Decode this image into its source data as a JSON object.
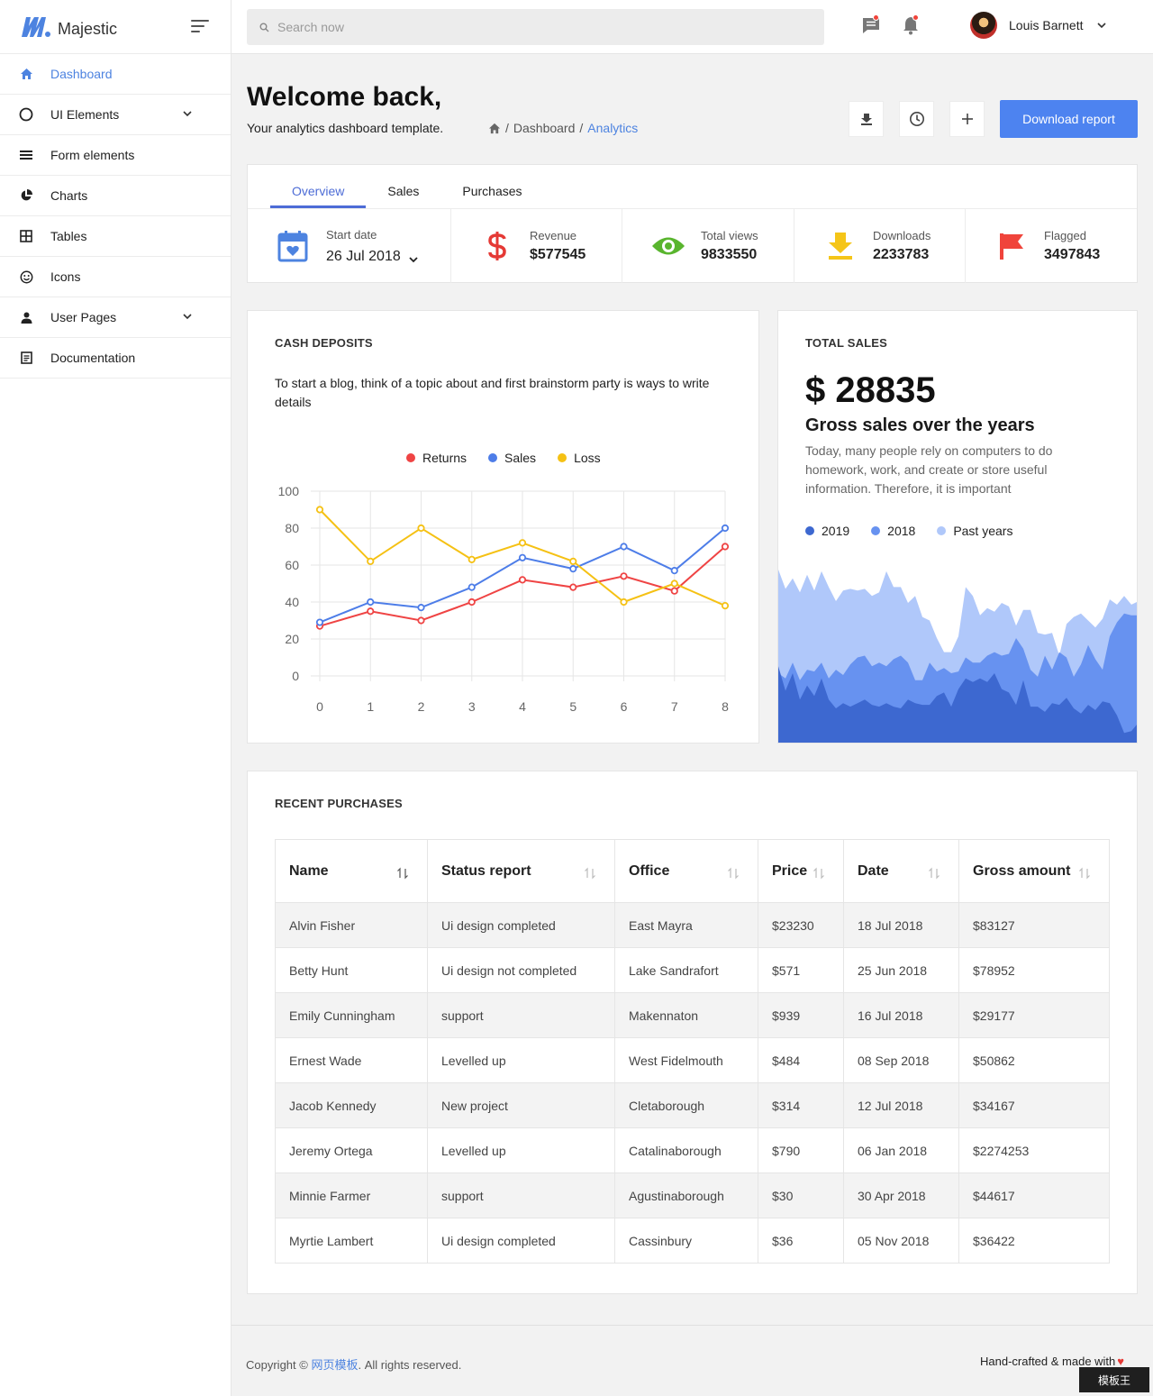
{
  "brand": {
    "name": "Majestic",
    "color": "#4d83e0"
  },
  "sidebar": {
    "items": [
      {
        "label": "Dashboard",
        "icon": "home-icon",
        "active": true
      },
      {
        "label": "UI Elements",
        "icon": "circle-icon",
        "expandable": true
      },
      {
        "label": "Form elements",
        "icon": "list-icon"
      },
      {
        "label": "Charts",
        "icon": "pie-chart-icon"
      },
      {
        "label": "Tables",
        "icon": "grid-icon"
      },
      {
        "label": "Icons",
        "icon": "smiley-icon"
      },
      {
        "label": "User Pages",
        "icon": "user-icon",
        "expandable": true
      },
      {
        "label": "Documentation",
        "icon": "document-icon"
      }
    ]
  },
  "topbar": {
    "search_placeholder": "Search now",
    "user_name": "Louis Barnett"
  },
  "header": {
    "title": "Welcome back,",
    "subtitle": "Your analytics dashboard template.",
    "breadcrumb": [
      "Dashboard",
      "Analytics"
    ],
    "download_label": "Download report"
  },
  "overview": {
    "tabs": [
      "Overview",
      "Sales",
      "Purchases"
    ],
    "stats": [
      {
        "label": "Start date",
        "value": "26 Jul 2018",
        "icon": "calendar-icon",
        "color": "#4d83e0"
      },
      {
        "label": "Revenue",
        "value": "$577545",
        "icon": "dollar-icon",
        "color": "#e53935"
      },
      {
        "label": "Total views",
        "value": "9833550",
        "icon": "eye-icon",
        "color": "#59b52e"
      },
      {
        "label": "Downloads",
        "value": "2233783",
        "icon": "download-icon",
        "color": "#f5c518"
      },
      {
        "label": "Flagged",
        "value": "3497843",
        "icon": "flag-icon",
        "color": "#f0443b"
      }
    ]
  },
  "cash": {
    "title": "CASH DEPOSITS",
    "description": "To start a blog, think of a topic about and first brainstorm party is ways to write details"
  },
  "chart_data": [
    {
      "type": "line",
      "x": [
        0,
        1,
        2,
        3,
        4,
        5,
        6,
        7,
        8
      ],
      "xlim": [
        0,
        8
      ],
      "ylim": [
        0,
        100
      ],
      "yticks": [
        0,
        20,
        40,
        60,
        80,
        100
      ],
      "legend": "top-center",
      "grid": true,
      "series": [
        {
          "name": "Returns",
          "color": "#ef4444",
          "values": [
            27,
            35,
            30,
            40,
            52,
            48,
            54,
            46,
            70
          ]
        },
        {
          "name": "Sales",
          "color": "#4d7de8",
          "values": [
            29,
            40,
            37,
            48,
            64,
            58,
            70,
            57,
            80
          ]
        },
        {
          "name": "Loss",
          "color": "#f5c114",
          "values": [
            90,
            62,
            80,
            63,
            72,
            62,
            40,
            50,
            38
          ]
        }
      ]
    },
    {
      "type": "area",
      "legend": "top-left",
      "grid": false,
      "x": [
        0,
        1,
        2,
        3,
        4,
        5,
        6,
        7,
        8,
        9,
        10,
        11,
        12,
        13,
        14,
        15,
        16,
        17,
        18,
        19,
        20,
        21,
        22,
        23,
        24,
        25,
        26,
        27,
        28,
        29,
        30,
        31,
        32,
        33,
        34,
        35,
        36,
        37,
        38,
        39,
        40,
        41,
        42,
        43,
        44,
        45,
        46,
        47,
        48,
        49,
        50
      ],
      "ylim": [
        0,
        100
      ],
      "series": [
        {
          "name": "2019",
          "color": "#3d68d0",
          "values": [
            44,
            30,
            40,
            25,
            33,
            27,
            37,
            25,
            20,
            23,
            21,
            23,
            25,
            22,
            21,
            23,
            21,
            20,
            25,
            23,
            22,
            22,
            27,
            29,
            21,
            31,
            37,
            35,
            37,
            35,
            40,
            31,
            29,
            22,
            36,
            21,
            21,
            18,
            23,
            22,
            26,
            20,
            17,
            22,
            19,
            24,
            23,
            16,
            6,
            7,
            12
          ]
        },
        {
          "name": "2018",
          "color": "#6792f0",
          "values": [
            40,
            37,
            46,
            36,
            42,
            41,
            46,
            37,
            42,
            39,
            45,
            49,
            50,
            44,
            46,
            44,
            48,
            50,
            46,
            36,
            36,
            46,
            41,
            43,
            40,
            41,
            49,
            46,
            46,
            50,
            52,
            50,
            51,
            60,
            54,
            42,
            38,
            50,
            42,
            52,
            49,
            38,
            45,
            56,
            48,
            42,
            61,
            69,
            74,
            73,
            73
          ]
        },
        {
          "name": "Past years",
          "color": "#b0c8fa",
          "values": [
            99,
            88,
            94,
            86,
            96,
            87,
            98,
            89,
            81,
            87,
            88,
            87,
            88,
            84,
            86,
            98,
            89,
            89,
            80,
            84,
            72,
            70,
            60,
            52,
            52,
            61,
            89,
            84,
            73,
            77,
            75,
            80,
            78,
            67,
            76,
            76,
            63,
            62,
            63,
            50,
            68,
            72,
            74,
            70,
            66,
            71,
            82,
            79,
            84,
            79,
            81
          ]
        }
      ]
    }
  ],
  "total_sales": {
    "title": "TOTAL SALES",
    "amount": "$ 28835",
    "heading": "Gross sales over the years",
    "description": "Today, many people rely on computers to do homework, work, and create or store useful information. Therefore, it is important"
  },
  "purchases": {
    "title": "RECENT PURCHASES",
    "columns": [
      "Name",
      "Status report",
      "Office",
      "Price",
      "Date",
      "Gross amount"
    ],
    "rows": [
      [
        "Alvin Fisher",
        "Ui design completed",
        "East Mayra",
        "$23230",
        "18 Jul 2018",
        "$83127"
      ],
      [
        "Betty Hunt",
        "Ui design not completed",
        "Lake Sandrafort",
        "$571",
        "25 Jun 2018",
        "$78952"
      ],
      [
        "Emily Cunningham",
        "support",
        "Makennaton",
        "$939",
        "16 Jul 2018",
        "$29177"
      ],
      [
        "Ernest Wade",
        "Levelled up",
        "West Fidelmouth",
        "$484",
        "08 Sep 2018",
        "$50862"
      ],
      [
        "Jacob Kennedy",
        "New project",
        "Cletaborough",
        "$314",
        "12 Jul 2018",
        "$34167"
      ],
      [
        "Jeremy Ortega",
        "Levelled up",
        "Catalinaborough",
        "$790",
        "06 Jan 2018",
        "$2274253"
      ],
      [
        "Minnie Farmer",
        "support",
        "Agustinaborough",
        "$30",
        "30 Apr 2018",
        "$44617"
      ],
      [
        "Myrtie Lambert",
        "Ui design completed",
        "Cassinbury",
        "$36",
        "05 Nov 2018",
        "$36422"
      ]
    ]
  },
  "footer": {
    "copyright_prefix": "Copyright ©",
    "copyright_link": "网页模板",
    "copyright_suffix": ". All rights reserved.",
    "handcrafted": "Hand-crafted & made with",
    "watermark": "模板王"
  }
}
